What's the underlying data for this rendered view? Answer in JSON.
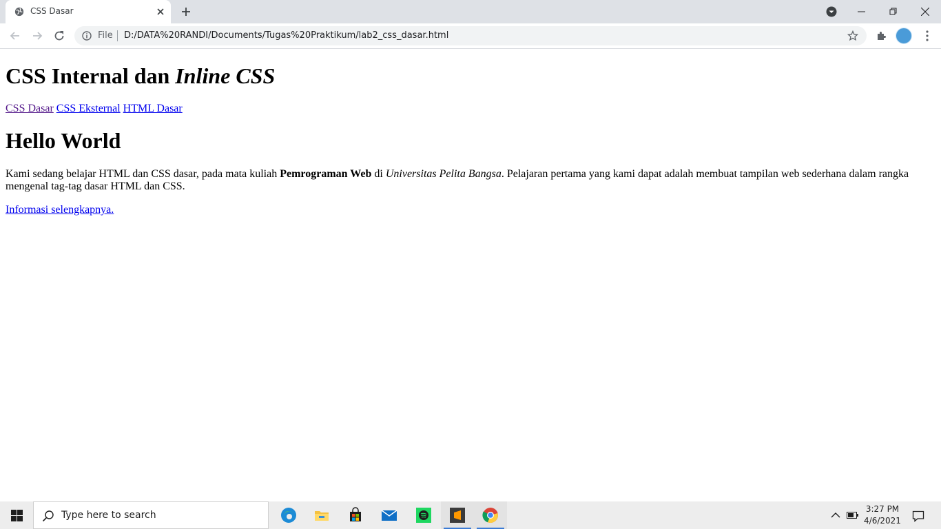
{
  "browser": {
    "tab_title": "CSS Dasar",
    "address_scheme": "File",
    "address_url": "D:/DATA%20RANDI/Documents/Tugas%20Praktikum/lab2_css_dasar.html",
    "icons": [
      "globe-icon",
      "close-icon",
      "plus-icon",
      "profile-dropdown-icon",
      "minimize-icon",
      "restore-icon",
      "close-window-icon",
      "back-arrow-icon",
      "forward-arrow-icon",
      "reload-icon",
      "info-icon",
      "star-icon",
      "puzzle-icon",
      "menu-dots-icon"
    ]
  },
  "page": {
    "heading_plain": "CSS Internal dan ",
    "heading_italic": "Inline CSS",
    "nav_links": [
      {
        "label": "CSS Dasar",
        "visited": true
      },
      {
        "label": "CSS Eksternal",
        "visited": false
      },
      {
        "label": "HTML Dasar",
        "visited": false
      }
    ],
    "hello_title": "Hello World",
    "para_part1": "Kami sedang belajar HTML dan CSS dasar, pada mata kuliah ",
    "para_bold": "Pemrograman Web",
    "para_part2": " di ",
    "para_italic": "Universitas Pelita Bangsa",
    "para_part3": ". Pelajaran pertama yang kami dapat adalah membuat tampilan web sederhana dalam rangka mengenal tag-tag dasar HTML dan CSS.",
    "more_link": "Informasi selengkapnya."
  },
  "taskbar": {
    "search_placeholder": "Type here to search",
    "time": "3:27 PM",
    "date": "4/6/2021",
    "apps": [
      "edge-icon",
      "file-explorer-icon",
      "store-icon",
      "mail-icon",
      "spotify-icon",
      "sublime-text-icon",
      "chrome-icon"
    ]
  },
  "colors": {
    "link": "#0000ee",
    "visited_link": "#551a8b",
    "tabstrip": "#dee1e6",
    "taskbar": "#ededed"
  }
}
